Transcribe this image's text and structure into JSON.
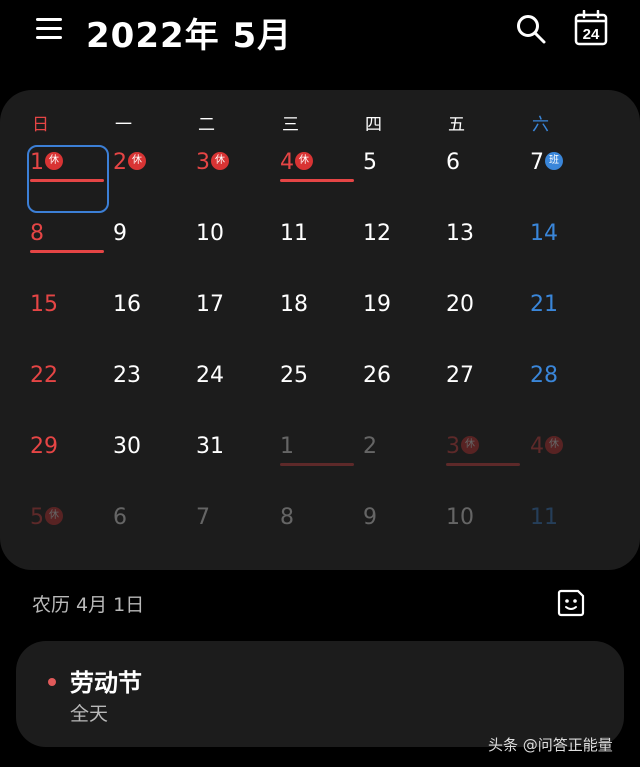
{
  "header": {
    "title": "2022年  5月",
    "menu_icon": "menu-icon",
    "search_icon": "search-icon",
    "today_label": "24"
  },
  "weekdays": [
    "日",
    "一",
    "二",
    "三",
    "四",
    "五",
    "六"
  ],
  "colors": {
    "sunday": "#e54545",
    "saturday": "#3a86d9",
    "weekday": "#ffffff",
    "holiday_badge": "#d83434",
    "work_badge": "#3a86d9",
    "selected_border": "#3c7fd6",
    "event_dot": "#e05a5a"
  },
  "calendar": {
    "weeks": [
      [
        {
          "day": "1",
          "type": "holiday",
          "badge": "休",
          "underline": true,
          "selected": true
        },
        {
          "day": "2",
          "type": "holiday",
          "badge": "休"
        },
        {
          "day": "3",
          "type": "holiday",
          "badge": "休"
        },
        {
          "day": "4",
          "type": "holiday",
          "badge": "休",
          "underline": true
        },
        {
          "day": "5",
          "type": "normal"
        },
        {
          "day": "6",
          "type": "normal"
        },
        {
          "day": "7",
          "type": "normal",
          "badge": "班",
          "badge_type": "work"
        }
      ],
      [
        {
          "day": "8",
          "type": "holiday",
          "underline": true
        },
        {
          "day": "9",
          "type": "normal"
        },
        {
          "day": "10",
          "type": "normal"
        },
        {
          "day": "11",
          "type": "normal"
        },
        {
          "day": "12",
          "type": "normal"
        },
        {
          "day": "13",
          "type": "normal"
        },
        {
          "day": "14",
          "type": "saturday"
        }
      ],
      [
        {
          "day": "15",
          "type": "holiday"
        },
        {
          "day": "16",
          "type": "normal"
        },
        {
          "day": "17",
          "type": "normal"
        },
        {
          "day": "18",
          "type": "normal"
        },
        {
          "day": "19",
          "type": "normal"
        },
        {
          "day": "20",
          "type": "normal"
        },
        {
          "day": "21",
          "type": "saturday"
        }
      ],
      [
        {
          "day": "22",
          "type": "holiday"
        },
        {
          "day": "23",
          "type": "normal"
        },
        {
          "day": "24",
          "type": "normal"
        },
        {
          "day": "25",
          "type": "normal"
        },
        {
          "day": "26",
          "type": "normal"
        },
        {
          "day": "27",
          "type": "normal"
        },
        {
          "day": "28",
          "type": "saturday"
        }
      ],
      [
        {
          "day": "29",
          "type": "holiday"
        },
        {
          "day": "30",
          "type": "normal"
        },
        {
          "day": "31",
          "type": "normal"
        },
        {
          "day": "1",
          "type": "normal",
          "faded": true,
          "underline": true
        },
        {
          "day": "2",
          "type": "normal",
          "faded": true
        },
        {
          "day": "3",
          "type": "holiday",
          "faded": true,
          "badge": "休",
          "underline": true
        },
        {
          "day": "4",
          "type": "holiday",
          "faded": true,
          "badge": "休"
        }
      ],
      [
        {
          "day": "5",
          "type": "holiday",
          "faded": true,
          "badge": "休"
        },
        {
          "day": "6",
          "type": "normal",
          "faded": true
        },
        {
          "day": "7",
          "type": "normal",
          "faded": true
        },
        {
          "day": "8",
          "type": "normal",
          "faded": true
        },
        {
          "day": "9",
          "type": "normal",
          "faded": true
        },
        {
          "day": "10",
          "type": "normal",
          "faded": true
        },
        {
          "day": "11",
          "type": "saturday",
          "faded": true
        }
      ]
    ]
  },
  "lunar_date": "农历 4月 1日",
  "sticker_icon": "sticker-icon",
  "event": {
    "title": "劳动节",
    "subtitle": "全天"
  },
  "watermark": "头条 @问答正能量"
}
